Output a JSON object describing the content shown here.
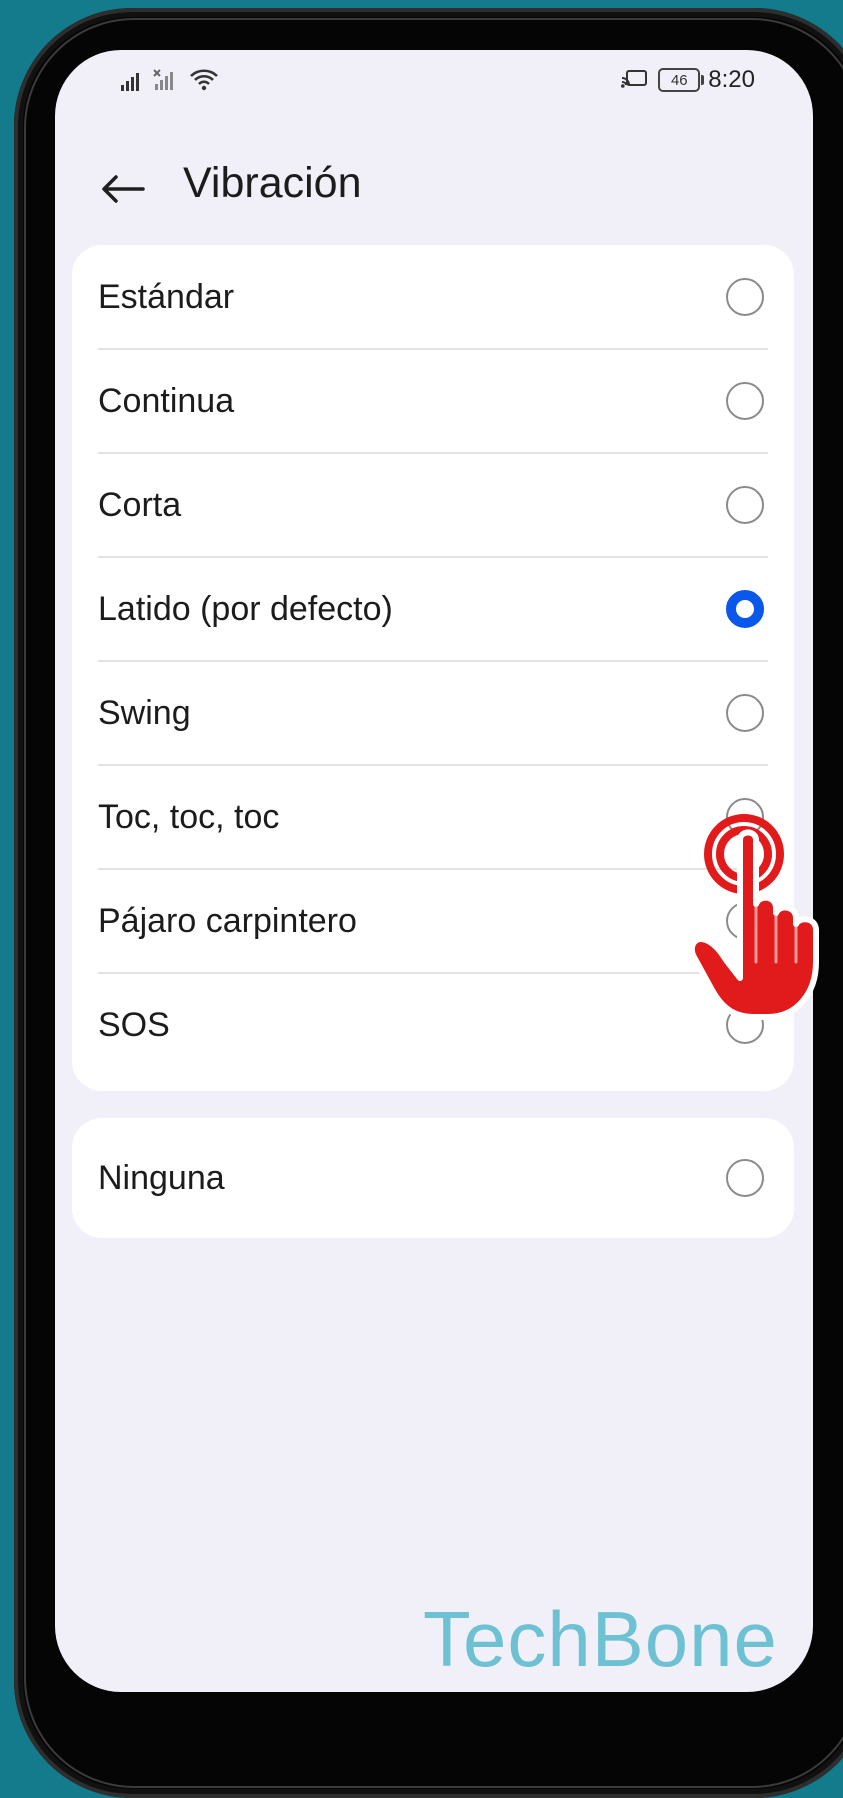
{
  "status_bar": {
    "time": "8:20",
    "battery": "46",
    "icons": [
      "signal-icon",
      "signal-muted-icon",
      "wifi-icon",
      "cast-icon",
      "battery-icon"
    ]
  },
  "header": {
    "title": "Vibración"
  },
  "options": [
    {
      "label": "Estándar",
      "selected": false
    },
    {
      "label": "Continua",
      "selected": false
    },
    {
      "label": "Corta",
      "selected": false
    },
    {
      "label": "Latido (por defecto)",
      "selected": true
    },
    {
      "label": "Swing",
      "selected": false
    },
    {
      "label": "Toc, toc, toc",
      "selected": false
    },
    {
      "label": "Pájaro carpintero",
      "selected": false
    },
    {
      "label": "SOS",
      "selected": false
    }
  ],
  "secondary_options": [
    {
      "label": "Ninguna",
      "selected": false
    }
  ],
  "colors": {
    "background": "#137b8c",
    "screen": "#f1f0f8",
    "accent": "#0a58ea",
    "pointer": "#e11b1b",
    "watermark": "#67bfd0"
  },
  "watermark": "TechBone",
  "pointer": {
    "icon": "hand-pointer-icon"
  }
}
